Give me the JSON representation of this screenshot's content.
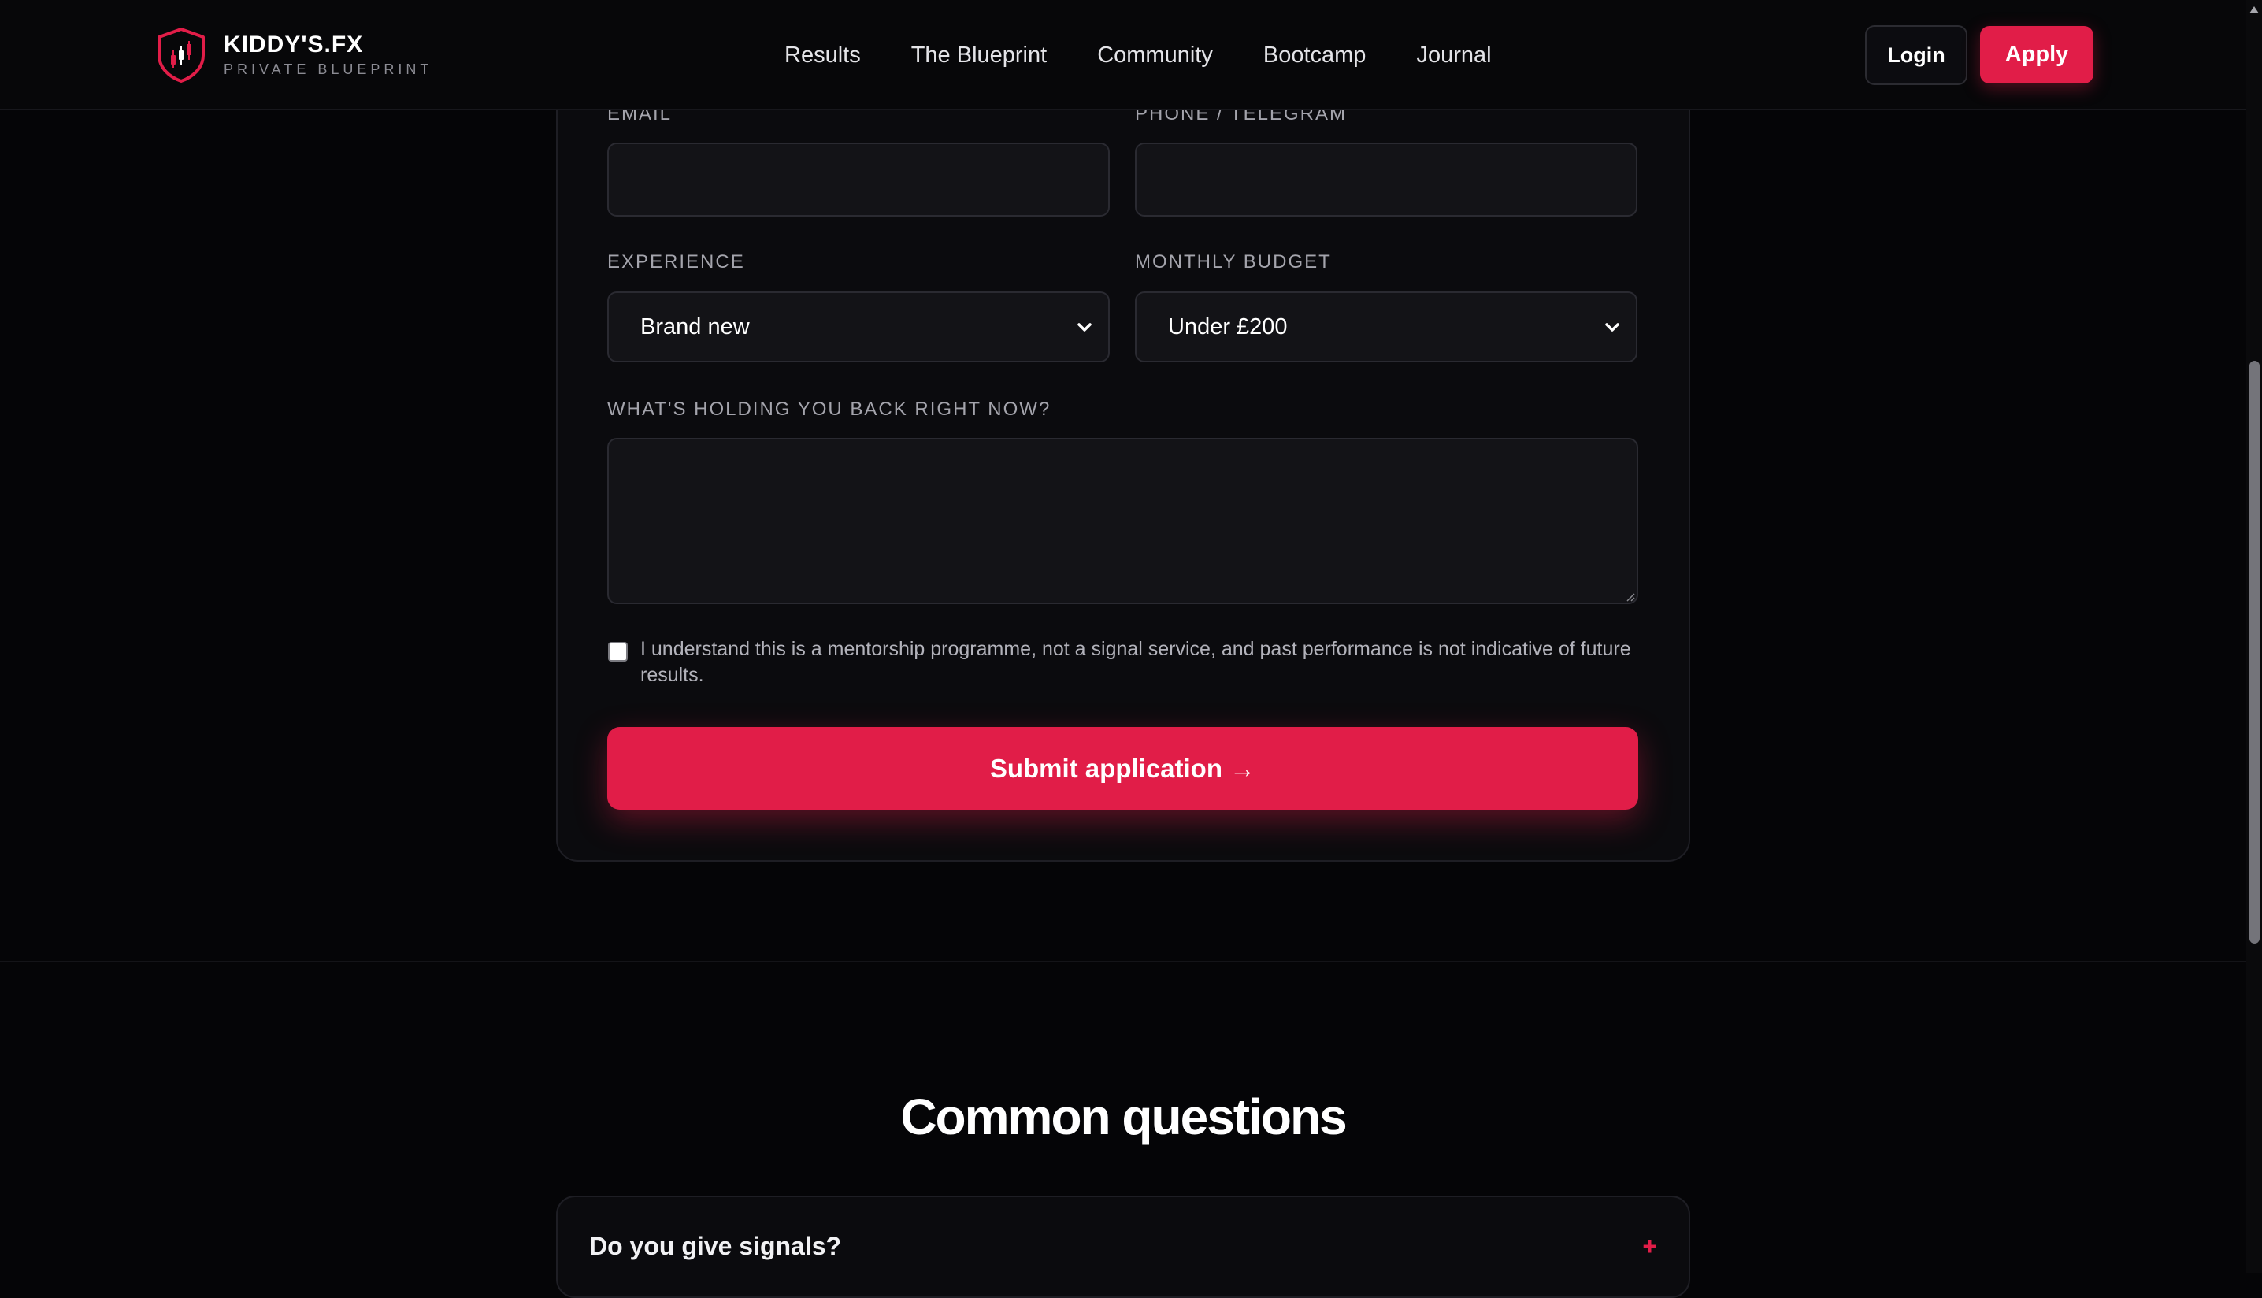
{
  "brand": {
    "name_main": "KIDDY'S",
    "name_suffix": ".FX",
    "tagline": "PRIVATE BLUEPRINT"
  },
  "nav": {
    "items": [
      {
        "label": "Results"
      },
      {
        "label": "The Blueprint"
      },
      {
        "label": "Community"
      },
      {
        "label": "Bootcamp"
      },
      {
        "label": "Journal"
      }
    ],
    "login_label": "Login",
    "apply_label": "Apply"
  },
  "form": {
    "email_label": "EMAIL",
    "email_value": "",
    "phone_label": "PHONE / TELEGRAM",
    "phone_value": "",
    "experience_label": "EXPERIENCE",
    "experience_value": "Brand new",
    "budget_label": "MONTHLY BUDGET",
    "budget_value": "Under £200",
    "holding_back_label": "WHAT'S HOLDING YOU BACK RIGHT NOW?",
    "holding_back_value": "",
    "consent_checked": false,
    "consent_text": "I understand this is a mentorship programme, not a signal service, and past performance is not indicative of future results.",
    "submit_label": "Submit application →"
  },
  "faq": {
    "title": "Common questions",
    "items": [
      {
        "question": "Do you give signals?",
        "toggle": "+"
      }
    ]
  },
  "colors": {
    "accent": "#e11d48",
    "background": "#050507",
    "card": "#0b0b0e",
    "input": "#131317"
  },
  "icons": {
    "brand_logo": "shield-candlestick-icon",
    "select_arrow": "chevron-down-icon",
    "faq_toggle": "plus-icon"
  }
}
